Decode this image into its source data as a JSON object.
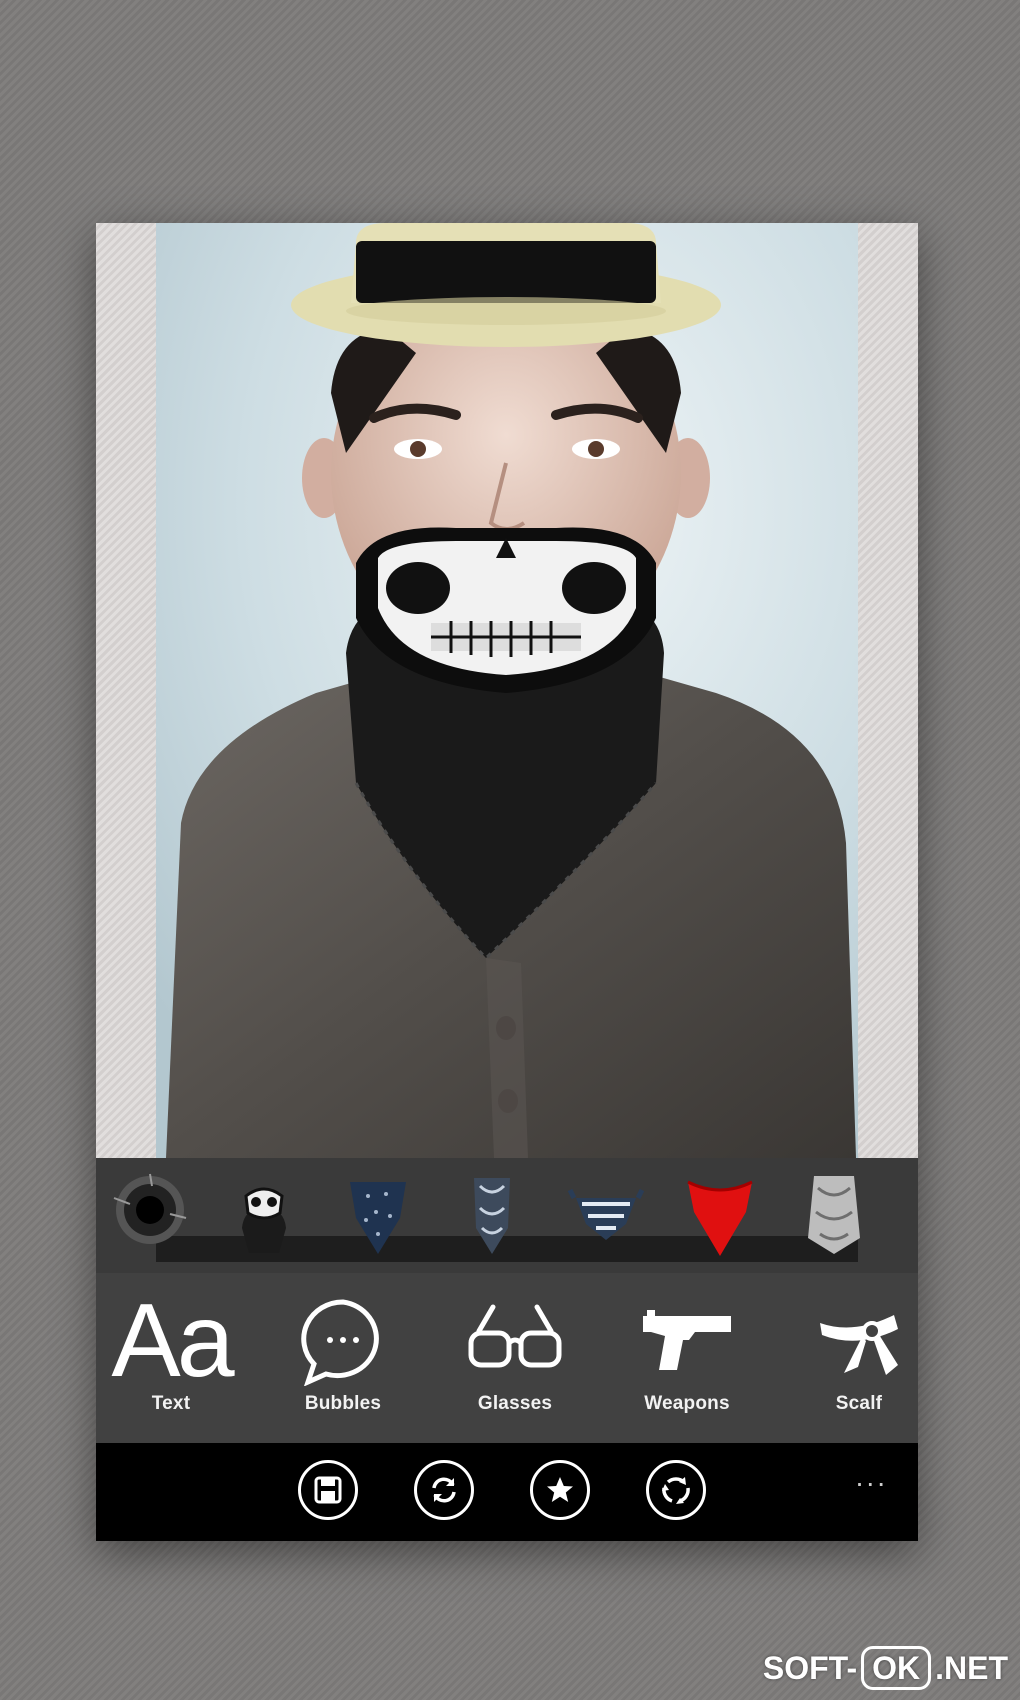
{
  "sticker_strip": {
    "items": [
      {
        "name": "bullet-hole-sticker"
      },
      {
        "name": "skull-mask-sticker"
      },
      {
        "name": "navy-bandana-sticker"
      },
      {
        "name": "paisley-mask-sticker"
      },
      {
        "name": "blue-bandana-sticker"
      },
      {
        "name": "red-bandana-sticker",
        "color": "#e01010"
      },
      {
        "name": "grey-scarf-sticker"
      }
    ]
  },
  "categories": [
    {
      "label": "Text",
      "icon": "text-aa-icon",
      "glyph": "Aa"
    },
    {
      "label": "Bubbles",
      "icon": "speech-bubble-icon"
    },
    {
      "label": "Glasses",
      "icon": "glasses-icon"
    },
    {
      "label": "Weapons",
      "icon": "pistol-icon"
    },
    {
      "label": "Scalf",
      "icon": "scarf-icon"
    }
  ],
  "app_bar": {
    "buttons": [
      {
        "icon": "save-icon"
      },
      {
        "icon": "refresh-icon"
      },
      {
        "icon": "star-icon"
      },
      {
        "icon": "share-icon"
      }
    ],
    "more": "..."
  },
  "watermark": {
    "left": "SOFT-",
    "middle": "OK",
    "right": ".NET"
  },
  "colors": {
    "strip_bg": "#3a3a3a",
    "category_bg": "#414141",
    "app_bar_bg": "#000000",
    "accent_red": "#e01010"
  }
}
